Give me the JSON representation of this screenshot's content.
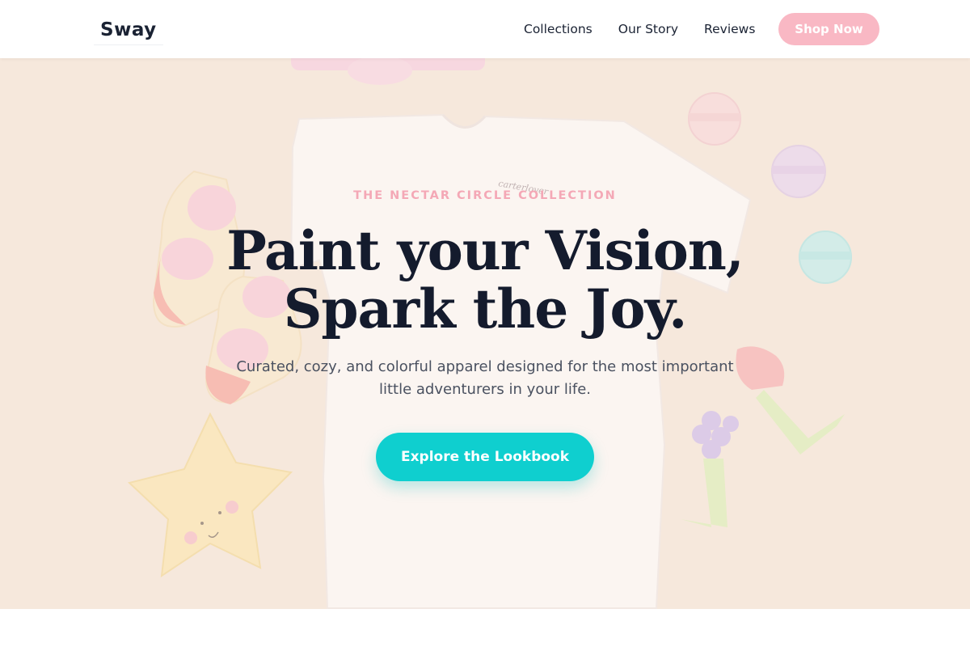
{
  "header": {
    "logo": "Sway",
    "nav": [
      {
        "label": "Collections"
      },
      {
        "label": "Our Story"
      },
      {
        "label": "Reviews"
      }
    ],
    "cta_label": "Shop Now"
  },
  "hero": {
    "eyebrow": "THE NECTAR CIRCLE COLLECTION",
    "headline_line1": "Paint your Vision,",
    "headline_line2": "Spark the Joy.",
    "subtext": "Curated, cozy, and colorful apparel designed for the most important little adventurers in your life.",
    "cta_label": "Explore the Lookbook",
    "shirt_tag": "carterlover"
  },
  "colors": {
    "accent_pink": "#f9b8c4",
    "accent_teal": "#0fcfcf",
    "hero_bg": "#f5e5d8",
    "text_dark": "#141b2d"
  }
}
